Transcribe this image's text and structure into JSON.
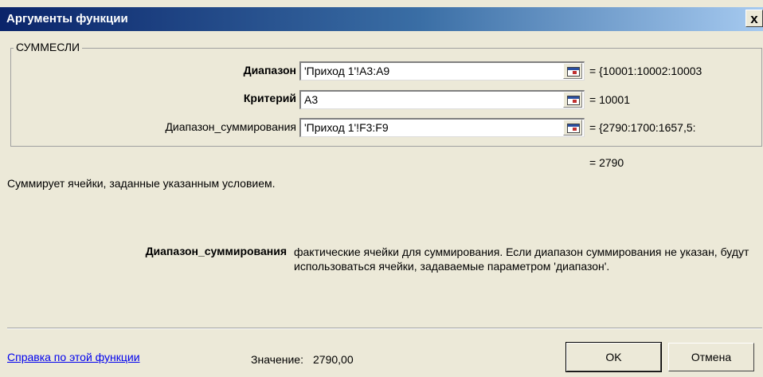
{
  "window": {
    "title": "Аргументы функции",
    "close_symbol": "x"
  },
  "function_group": {
    "name": "СУММЕСЛИ",
    "arguments": [
      {
        "label": "Диапазон",
        "value": "'Приход 1'!A3:A9",
        "result": "= {10001:10002:10003"
      },
      {
        "label": "Критерий",
        "value": "A3",
        "result": "= 10001"
      },
      {
        "label": "Диапазон_суммирования",
        "value": "'Приход 1'!F3:F9",
        "result": "= {2790:1700:1657,5:"
      }
    ]
  },
  "formula_result": "= 2790",
  "description": "Суммирует ячейки, заданные указанным условием.",
  "argument_help": {
    "name": "Диапазон_суммирования",
    "text": "фактические ячейки для суммирования. Если диапазон суммирования не указан, будут использоваться ячейки, задаваемые параметром 'диапазон'."
  },
  "footer": {
    "help_link": "Справка по этой функции",
    "value_label": "Значение:",
    "value": "2790,00",
    "ok_label": "OK",
    "cancel_label": "Отмена"
  }
}
